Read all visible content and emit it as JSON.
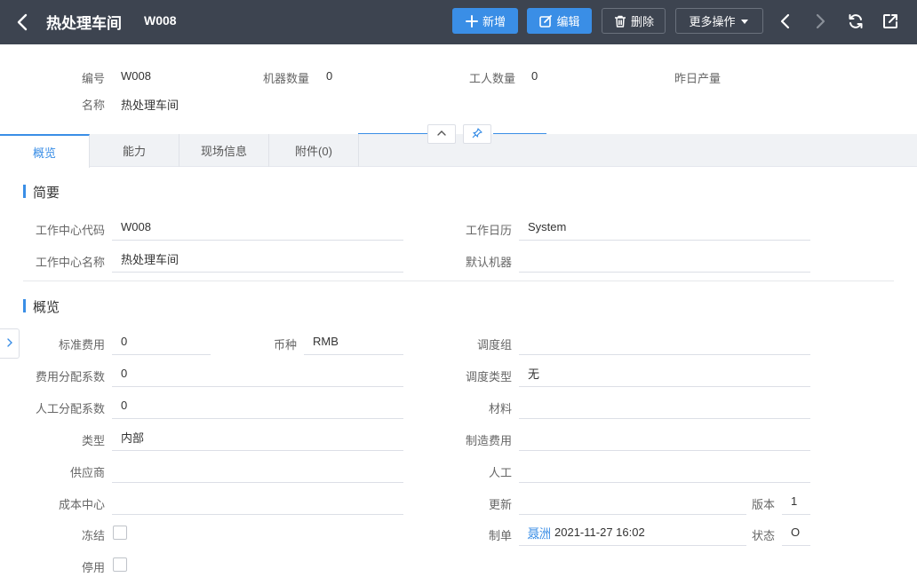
{
  "header": {
    "title": "热处理车间",
    "code": "W008",
    "buttons": {
      "add": "新增",
      "edit": "编辑",
      "delete": "删除",
      "more": "更多操作"
    }
  },
  "summary": {
    "code_label": "编号",
    "code_value": "W008",
    "name_label": "名称",
    "name_value": "热处理车间",
    "machines_label": "机器数量",
    "machines_value": "0",
    "workers_label": "工人数量",
    "workers_value": "0",
    "yesterday_label": "昨日产量",
    "yesterday_value": ""
  },
  "tabs": [
    {
      "label": "概览",
      "active": true
    },
    {
      "label": "能力",
      "active": false
    },
    {
      "label": "现场信息",
      "active": false
    },
    {
      "label": "附件(0)",
      "active": false
    }
  ],
  "section_brief": {
    "title": "简要",
    "wc_code_label": "工作中心代码",
    "wc_code_value": "W008",
    "wc_name_label": "工作中心名称",
    "wc_name_value": "热处理车间",
    "calendar_label": "工作日历",
    "calendar_value": "System",
    "default_machine_label": "默认机器",
    "default_machine_value": ""
  },
  "section_overview": {
    "title": "概览",
    "std_cost_label": "标准费用",
    "std_cost_value": "0",
    "currency_label": "币种",
    "currency_value": "RMB",
    "cost_alloc_label": "费用分配系数",
    "cost_alloc_value": "0",
    "labor_alloc_label": "人工分配系数",
    "labor_alloc_value": "0",
    "type_label": "类型",
    "type_value": "内部",
    "supplier_label": "供应商",
    "supplier_value": "",
    "cost_center_label": "成本中心",
    "cost_center_value": "",
    "frozen_label": "冻结",
    "disabled_label": "停用",
    "dispatch_group_label": "调度组",
    "dispatch_group_value": "",
    "dispatch_type_label": "调度类型",
    "dispatch_type_value": "无",
    "material_label": "材料",
    "material_value": "",
    "mfg_cost_label": "制造费用",
    "mfg_cost_value": "",
    "labor_label": "人工",
    "labor_value": "",
    "update_label": "更新",
    "update_value": "",
    "version_label": "版本",
    "version_value": "1",
    "creator_label": "制单",
    "creator_name": "聂洲",
    "creator_time": "2021-11-27 16:02",
    "status_label": "状态",
    "status_value": "O"
  },
  "colors": {
    "header_bg": "#3d4450",
    "accent": "#3a8ee6"
  }
}
